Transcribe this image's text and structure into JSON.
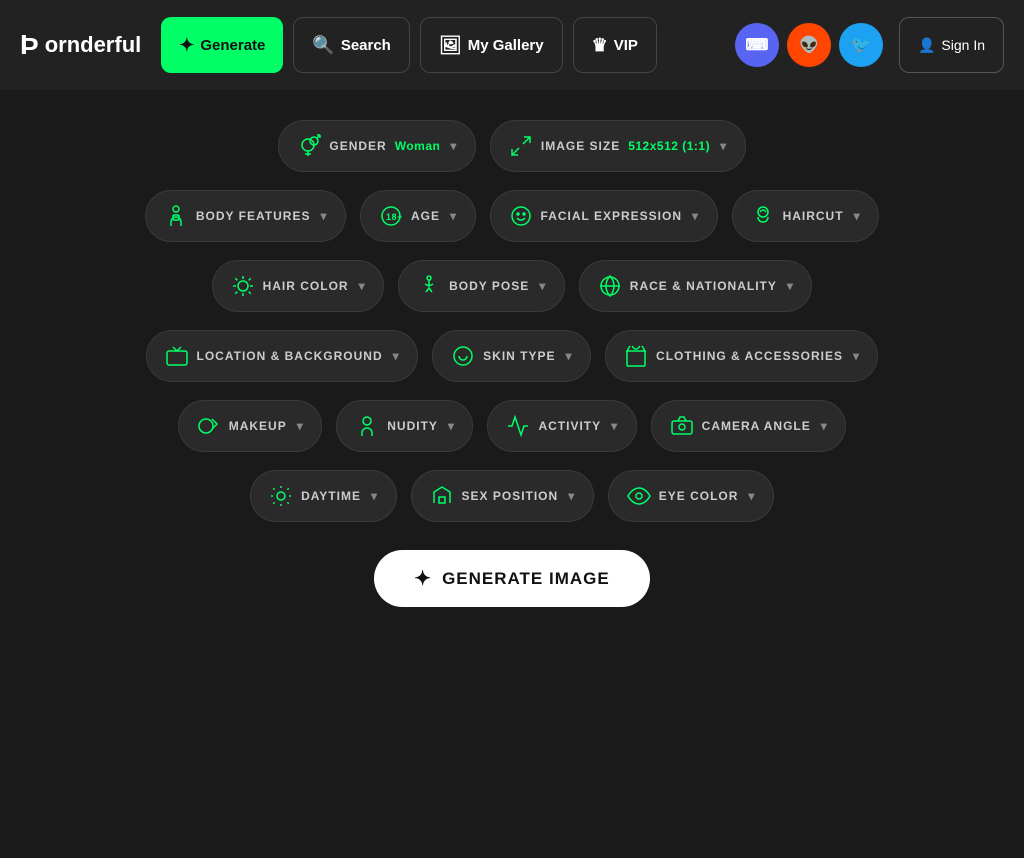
{
  "header": {
    "logo_text": "ornderful",
    "logo_prefix": "P",
    "nav": {
      "generate_label": "Generate",
      "search_label": "Search",
      "gallery_label": "My Gallery",
      "vip_label": "VIP",
      "signin_label": "Sign In"
    },
    "social": {
      "discord_label": "discord",
      "reddit_label": "reddit",
      "twitter_label": "twitter"
    }
  },
  "filters": {
    "gender": {
      "label": "GENDER",
      "value": "Woman"
    },
    "image_size": {
      "label": "IMAGE SIZE",
      "value": "512x512 (1:1)"
    },
    "body_features": {
      "label": "BODY FEATURES"
    },
    "age": {
      "label": "AGE"
    },
    "facial_expression": {
      "label": "FACIAL EXPRESSION"
    },
    "haircut": {
      "label": "HAIRCUT"
    },
    "hair_color": {
      "label": "HAIR COLOR"
    },
    "body_pose": {
      "label": "BODY POSE"
    },
    "race_nationality": {
      "label": "RACE & NATIONALITY"
    },
    "location_background": {
      "label": "LOCATION & BACKGROUND"
    },
    "skin_type": {
      "label": "SKIN TYPE"
    },
    "clothing_accessories": {
      "label": "CLOTHING & ACCESSORIES"
    },
    "makeup": {
      "label": "MAKEUP"
    },
    "nudity": {
      "label": "NUDITY"
    },
    "activity": {
      "label": "ACTIVITY"
    },
    "camera_angle": {
      "label": "CAMERA ANGLE"
    },
    "daytime": {
      "label": "DAYTIME"
    },
    "sex_position": {
      "label": "SEX POSITION"
    },
    "eye_color": {
      "label": "EYE COLOR"
    }
  },
  "generate_button": {
    "label": "GENERATE IMAGE"
  },
  "colors": {
    "accent": "#00ff66",
    "bg": "#1a1a1a",
    "header_bg": "#222222",
    "pill_bg": "#2a2a2a"
  }
}
